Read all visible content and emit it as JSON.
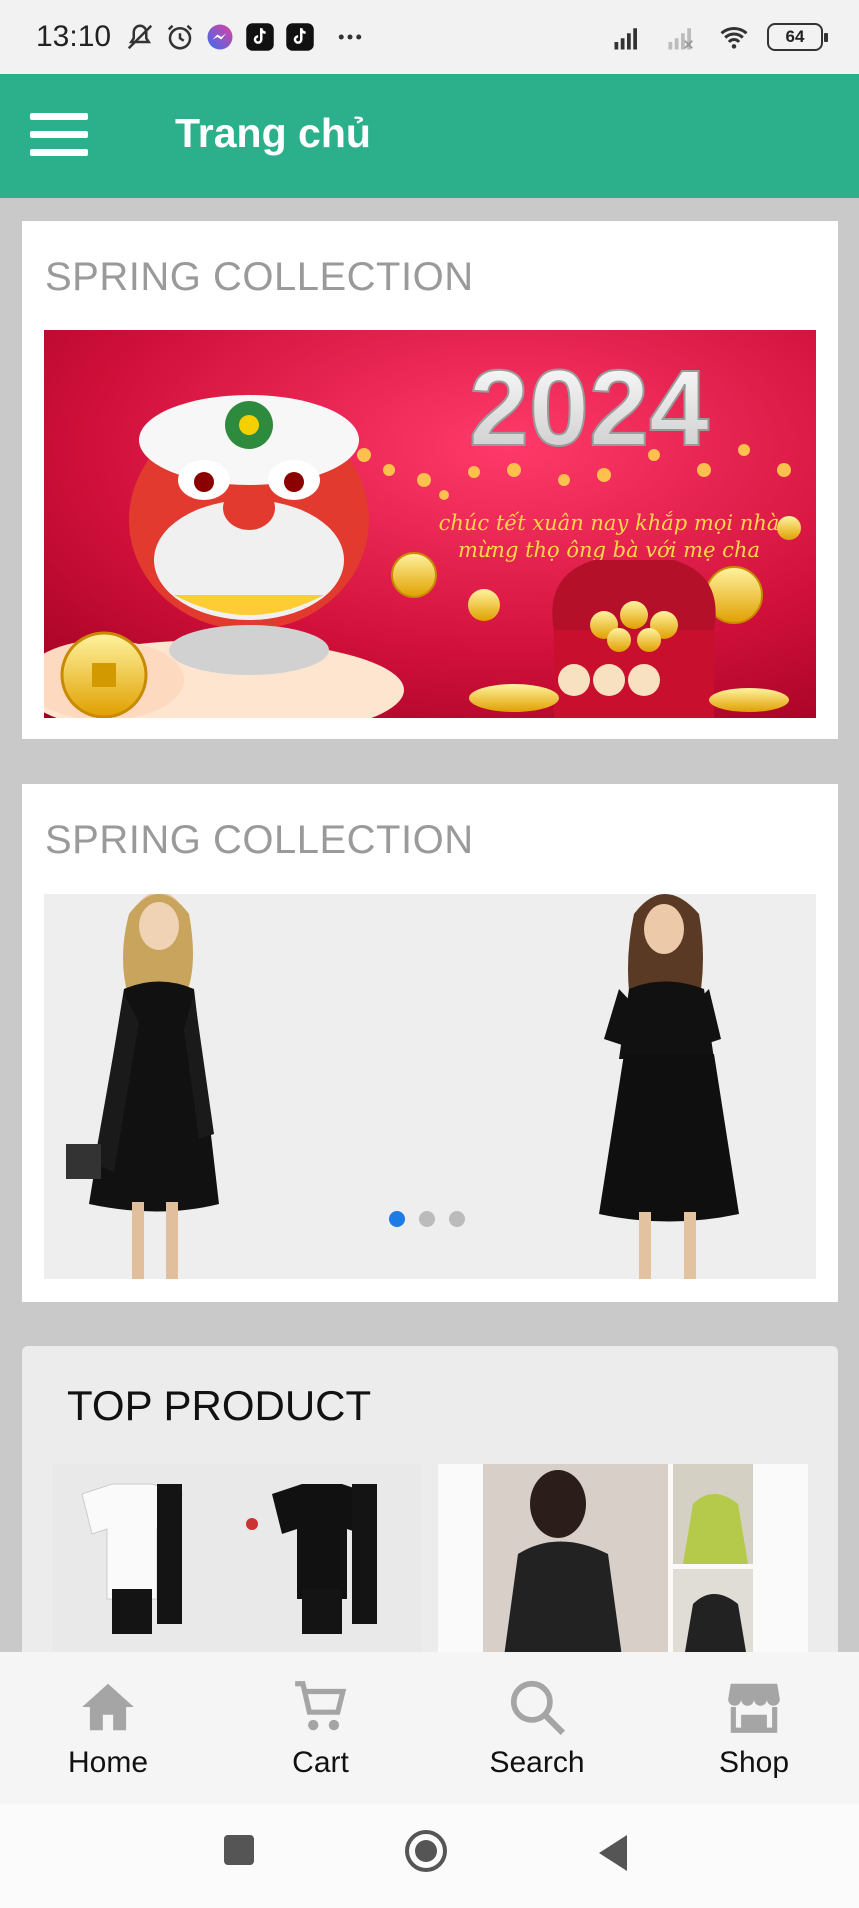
{
  "status_bar": {
    "time": "13:10",
    "battery": "64",
    "icons": [
      "mute-icon",
      "alarm-icon",
      "messenger-icon",
      "tiktok-icon",
      "tiktok-icon",
      "more-icon",
      "signal-icon",
      "signal-icon",
      "wifi-icon",
      "battery-icon"
    ]
  },
  "app_bar": {
    "title": "Trang chủ",
    "menu_icon": "hamburger-menu-icon"
  },
  "sections": [
    {
      "title": "SPRING COLLECTION",
      "banner": {
        "year": "2024",
        "line1": "chúc tết xuân nay khắp mọi nhà",
        "line2": "mừng thọ ông bà với mẹ cha"
      }
    },
    {
      "title": "SPRING COLLECTION",
      "carousel": {
        "slides": 3,
        "active": 0
      }
    }
  ],
  "top_product": {
    "title": "TOP PRODUCT"
  },
  "bottom_nav": [
    {
      "label": "Home",
      "icon": "home-icon"
    },
    {
      "label": "Cart",
      "icon": "cart-icon"
    },
    {
      "label": "Search",
      "icon": "search-icon"
    },
    {
      "label": "Shop",
      "icon": "shop-icon"
    }
  ],
  "colors": {
    "primary": "#2bb08b",
    "indicator_active": "#1e7be6",
    "banner_red": "#c8102e"
  }
}
